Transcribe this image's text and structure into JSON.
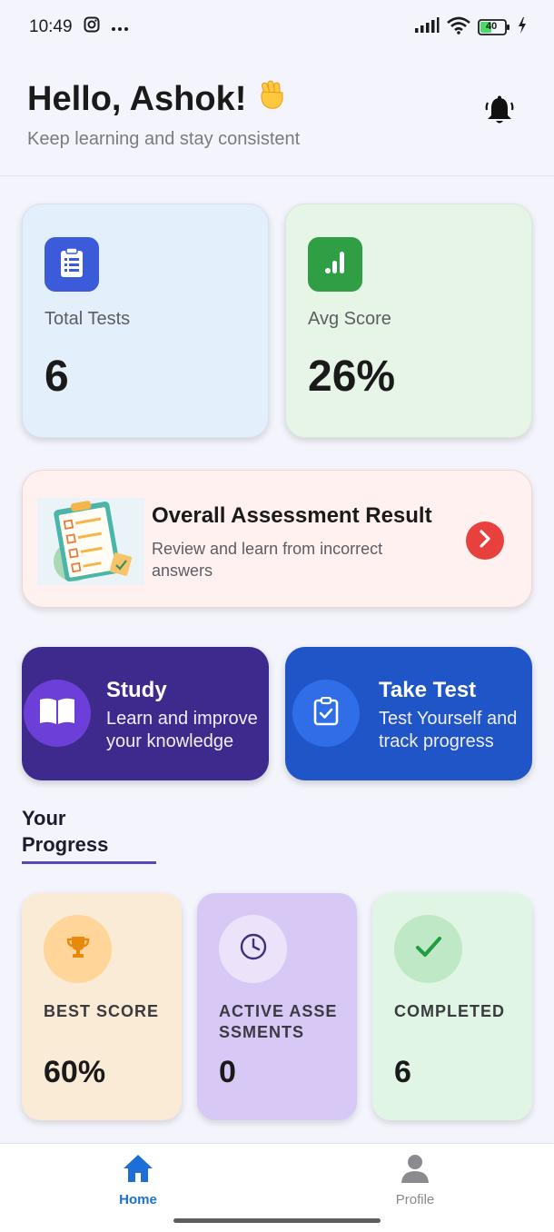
{
  "status_bar": {
    "time": "10:49",
    "battery": "40"
  },
  "header": {
    "greeting": "Hello, Ashok!",
    "subtitle": "Keep learning and stay consistent"
  },
  "stats": [
    {
      "label": "Total Tests",
      "value": "6",
      "icon": "clipboard-list-icon",
      "color": "#3b5bdb"
    },
    {
      "label": "Avg Score",
      "value": "26%",
      "icon": "bar-chart-icon",
      "color": "#2f9e44"
    }
  ],
  "assessment": {
    "title": "Overall Assessment Result",
    "description": "Review and learn from incorrect answers",
    "accent": "#e8403d"
  },
  "actions": [
    {
      "title": "Study",
      "description": "Learn and improve your knowledge",
      "icon": "book-icon",
      "color": "#3e2a8c"
    },
    {
      "title": "Take Test",
      "description": "Test Yourself and track progress",
      "icon": "clipboard-check-icon",
      "color": "#1f55c6"
    }
  ],
  "progress": {
    "heading": "Your Progress",
    "cards": [
      {
        "label": "BEST SCORE",
        "value": "60%",
        "icon": "trophy-icon",
        "color": "#faebd7"
      },
      {
        "label": "ACTIVE ASSESSMENTS",
        "value": "0",
        "icon": "clock-icon",
        "color": "#d8c8f6"
      },
      {
        "label": "COMPLETED",
        "value": "6",
        "icon": "check-icon",
        "color": "#e0f5e3"
      }
    ]
  },
  "nav": {
    "items": [
      {
        "label": "Home",
        "icon": "home-icon",
        "active": true
      },
      {
        "label": "Profile",
        "icon": "user-icon",
        "active": false
      }
    ],
    "active_color": "#1d6fd8"
  }
}
